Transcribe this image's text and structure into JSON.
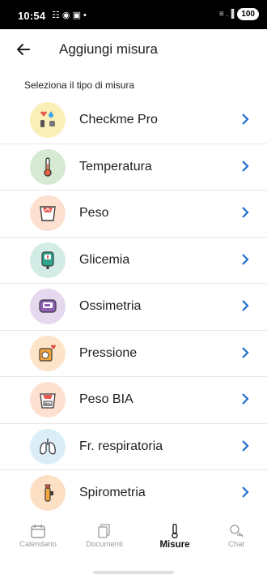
{
  "status_bar": {
    "time": "10:54",
    "left_icons": "☷ ◉ ▣ •",
    "signal": "≡ .▐",
    "battery": "100"
  },
  "header": {
    "back_icon": "arrow-left-icon",
    "title": "Aggiungi misura"
  },
  "section": {
    "label": "Seleziona il tipo di misura"
  },
  "measures": [
    {
      "label": "Checkme Pro",
      "icon": "checkme-device-icon",
      "bg": "#fbefb8"
    },
    {
      "label": "Temperatura",
      "icon": "thermometer-icon",
      "bg": "#d6ead3"
    },
    {
      "label": "Peso",
      "icon": "scale-icon",
      "bg": "#fde0cf"
    },
    {
      "label": "Glicemia",
      "icon": "glucometer-icon",
      "bg": "#d3ece6"
    },
    {
      "label": "Ossimetria",
      "icon": "oximeter-icon",
      "bg": "#e6d9ef"
    },
    {
      "label": "Pressione",
      "icon": "blood-pressure-icon",
      "bg": "#fde4c8"
    },
    {
      "label": "Peso BIA",
      "icon": "bia-scale-icon",
      "bg": "#fde0cf"
    },
    {
      "label": "Fr. respiratoria",
      "icon": "lungs-icon",
      "bg": "#dbeef8"
    },
    {
      "label": "Spirometria",
      "icon": "spirometer-icon",
      "bg": "#fde0c4"
    }
  ],
  "colors": {
    "accent": "#1f6fd1"
  },
  "bottom_nav": [
    {
      "label": "Calendario",
      "icon": "calendar-icon",
      "active": false
    },
    {
      "label": "Documenti",
      "icon": "documents-icon",
      "active": false
    },
    {
      "label": "Misure",
      "icon": "thermometer-icon",
      "active": true
    },
    {
      "label": "Chat",
      "icon": "chat-icon",
      "active": false
    }
  ]
}
